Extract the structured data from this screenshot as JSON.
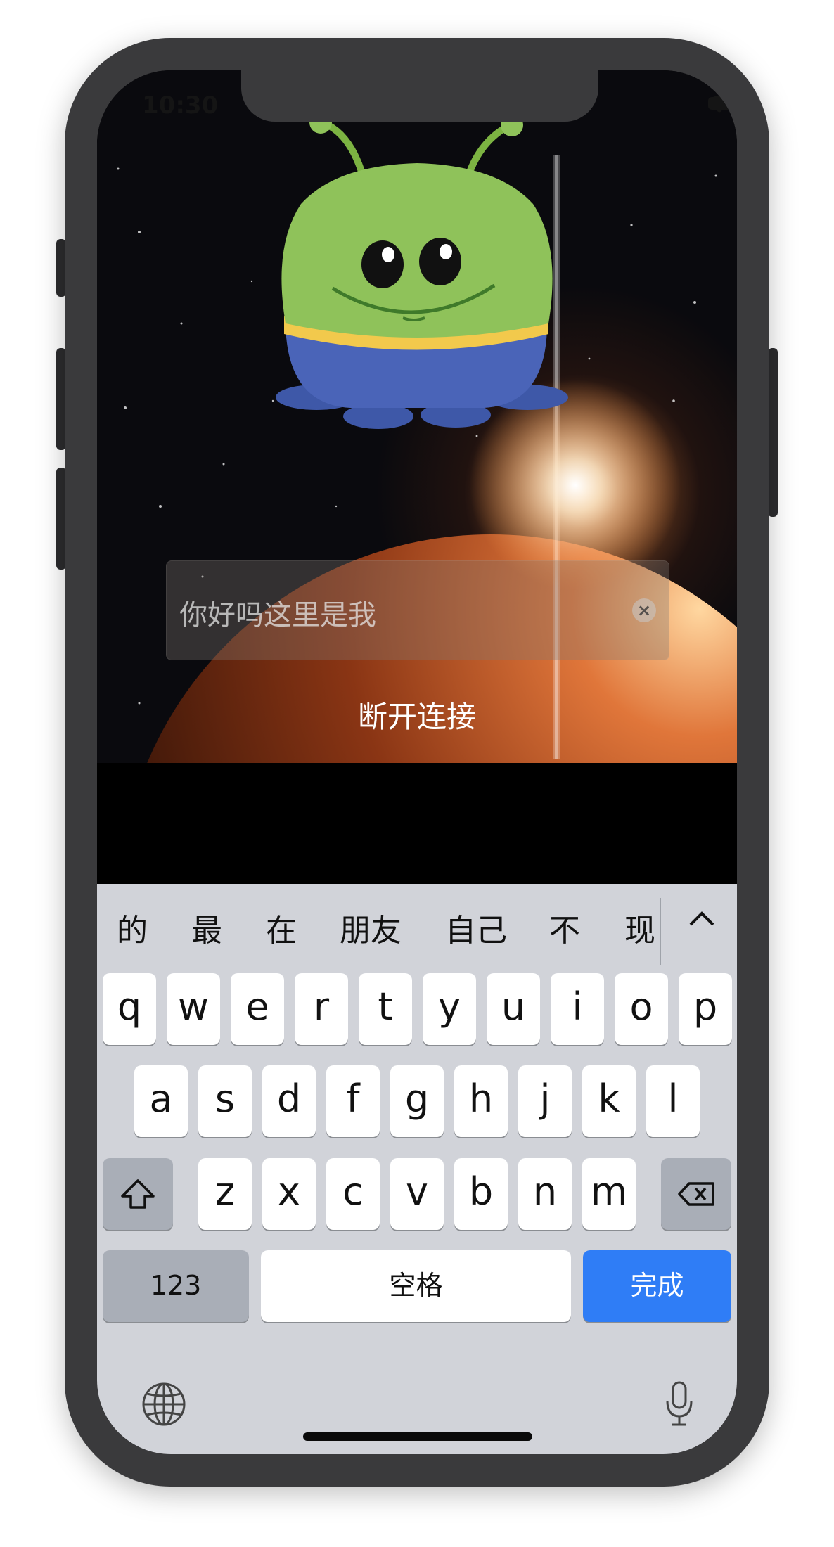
{
  "status_bar": {
    "time": "10:30"
  },
  "scene": {
    "mascot_icon": "green-alien-mascot",
    "background": "space-planet-sunrise"
  },
  "text_field": {
    "value": "你好吗这里是我",
    "clear_icon": "clear-circle-icon"
  },
  "disconnect_button": {
    "label": "断开连接"
  },
  "keyboard": {
    "candidates": [
      "的",
      "最",
      "在",
      "朋友",
      "自己",
      "不",
      "现"
    ],
    "expand_icon": "chevron-up-icon",
    "row1": [
      "q",
      "w",
      "e",
      "r",
      "t",
      "y",
      "u",
      "i",
      "o",
      "p"
    ],
    "row2": [
      "a",
      "s",
      "d",
      "f",
      "g",
      "h",
      "j",
      "k",
      "l"
    ],
    "row3": [
      "z",
      "x",
      "c",
      "v",
      "b",
      "n",
      "m"
    ],
    "shift_icon": "shift-arrow-icon",
    "backspace_icon": "backspace-icon",
    "numbers_label": "123",
    "space_label": "空格",
    "done_label": "完成",
    "globe_icon": "globe-icon",
    "mic_icon": "microphone-icon"
  },
  "colors": {
    "done_key": "#2f7df6",
    "keyboard_bg": "#d1d3d9",
    "alien_green": "#8fc25a",
    "alien_pants": "#4a64b8"
  }
}
